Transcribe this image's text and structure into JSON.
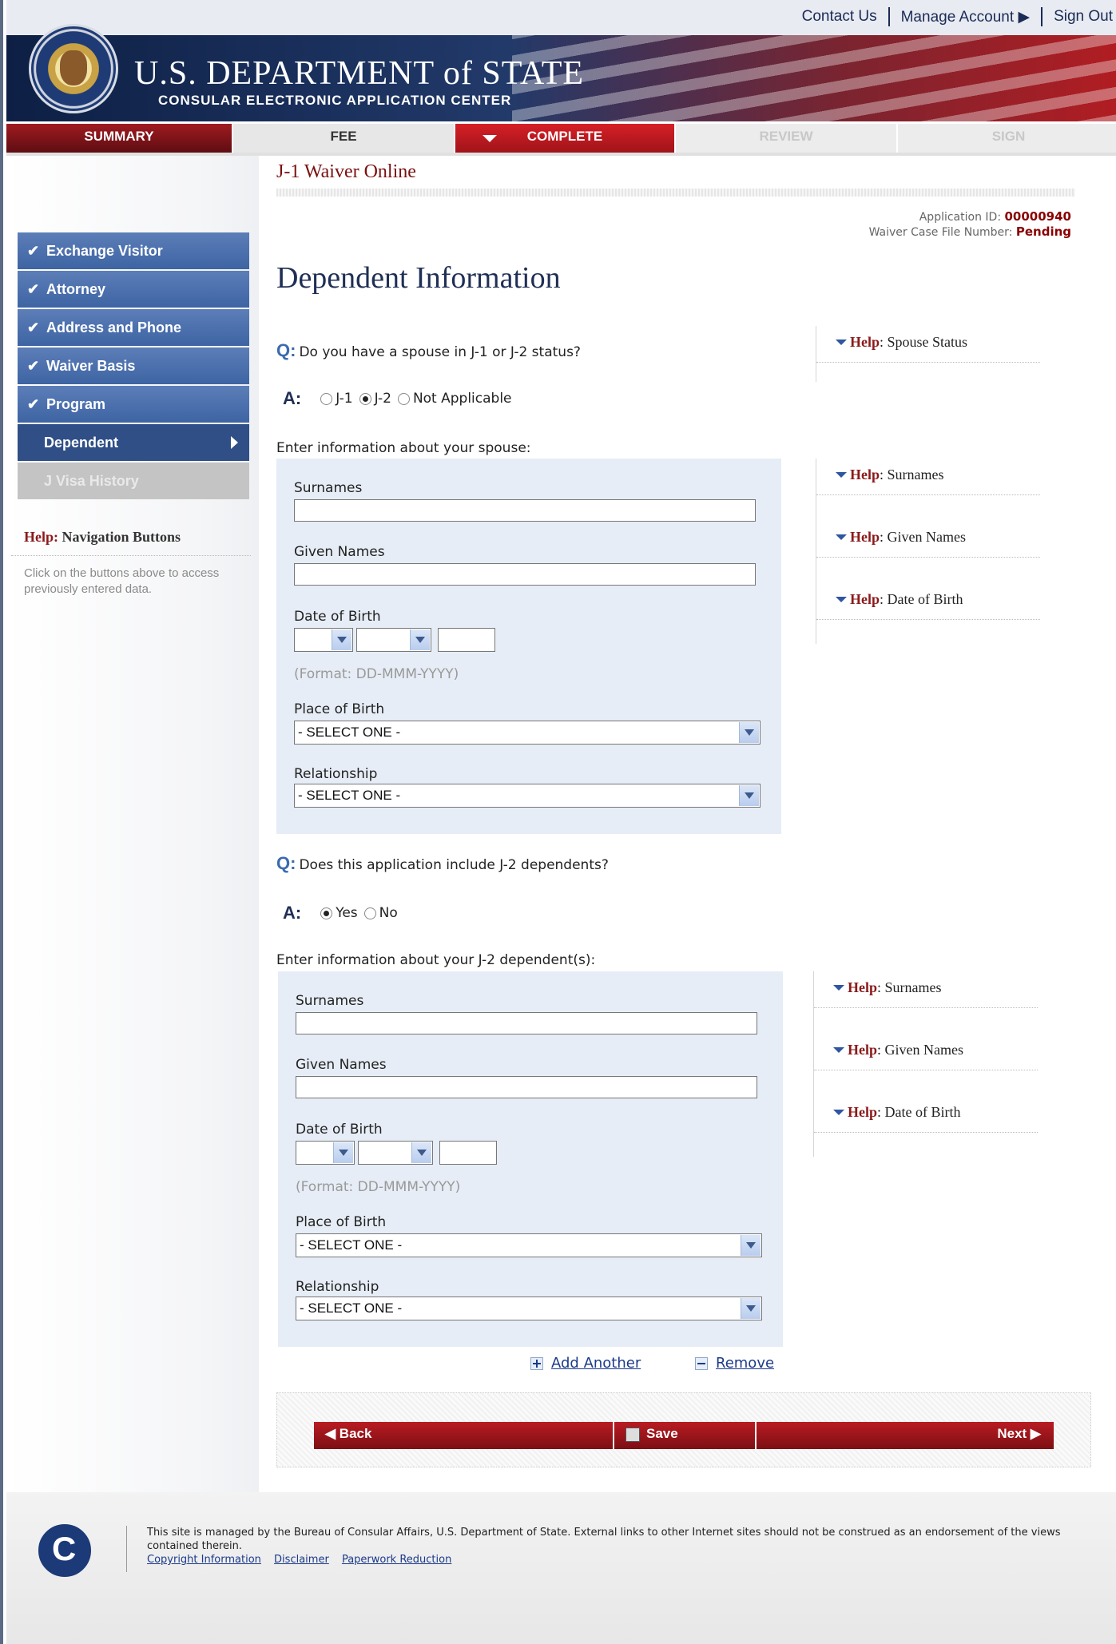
{
  "header": {
    "links": [
      "Contact Us",
      "Manage Account",
      "Sign Out"
    ],
    "title": "U.S. DEPARTMENT of STATE",
    "subtitle": "CONSULAR ELECTRONIC APPLICATION CENTER"
  },
  "steps": [
    "SUMMARY",
    "FEE",
    "COMPLETE",
    "REVIEW",
    "SIGN"
  ],
  "nav": {
    "items": [
      {
        "label": "Exchange Visitor"
      },
      {
        "label": "Attorney"
      },
      {
        "label": "Address and Phone"
      },
      {
        "label": "Waiver Basis"
      },
      {
        "label": "Program"
      },
      {
        "label": "Dependent"
      },
      {
        "label": "J Visa History"
      }
    ]
  },
  "left_help": {
    "title_prefix": "Help:",
    "title": "Navigation Buttons",
    "body": "Click on the buttons above to access previously entered data."
  },
  "app": {
    "name": "J-1 Waiver Online",
    "id_label": "Application ID:",
    "id_value": "00000940",
    "case_label": "Waiver Case File Number:",
    "case_value": "Pending"
  },
  "page_title": "Dependent Information",
  "q1": {
    "q_mark": "Q:",
    "text": "Do you have a spouse in J-1 or J-2 status?",
    "a_mark": "A:",
    "options": [
      "J-1",
      "J-2",
      "Not Applicable"
    ],
    "selected": "J-2"
  },
  "spouse": {
    "intro": "Enter information about your spouse:",
    "surnames": "Surnames",
    "given_names": "Given Names",
    "dob": "Date of Birth",
    "dob_format": "(Format: DD-MMM-YYYY)",
    "place_of_birth": "Place of Birth",
    "place_value": "- SELECT ONE -",
    "relationship": "Relationship",
    "relationship_value": "- SELECT ONE -"
  },
  "q2": {
    "q_mark": "Q:",
    "text": "Does this application include J-2 dependents?",
    "a_mark": "A:",
    "options": [
      "Yes",
      "No"
    ],
    "selected": "Yes"
  },
  "dependent": {
    "intro": "Enter information about your J-2 dependent(s):",
    "surnames": "Surnames",
    "given_names": "Given Names",
    "dob": "Date of Birth",
    "dob_format": "(Format: DD-MMM-YYYY)",
    "place_of_birth": "Place of Birth",
    "place_value": "- SELECT ONE -",
    "relationship": "Relationship",
    "relationship_value": "- SELECT ONE -"
  },
  "help": {
    "prefix": "Help",
    "spouse_status": ": Spouse Status",
    "surnames": ": Surnames",
    "given_names": ": Given Names",
    "dob": ": Date of Birth"
  },
  "add_another": "Add Another",
  "remove": "Remove",
  "buttons": {
    "back": "Back",
    "save": "Save",
    "next": "Next"
  },
  "footer": {
    "text": "This site is managed by the Bureau of Consular Affairs, U.S. Department of State. External links to other Internet sites should not be construed as an endorsement of the views contained therein.",
    "links": [
      "Copyright Information",
      "Disclaimer",
      "Paperwork Reduction"
    ]
  }
}
